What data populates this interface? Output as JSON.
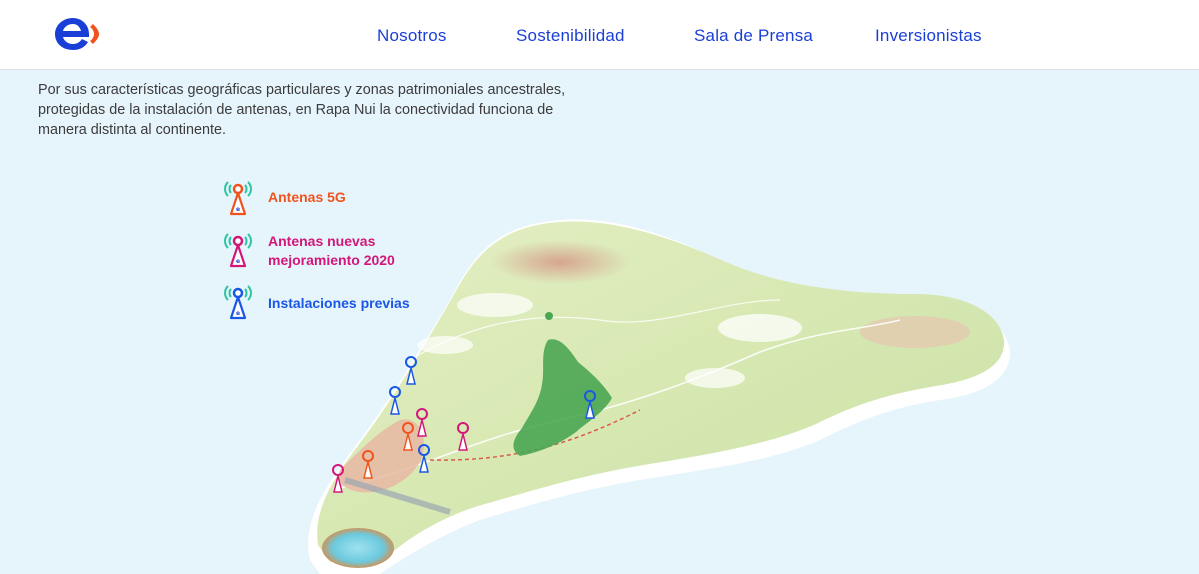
{
  "header": {
    "logo_name": "enel-logo",
    "nav": [
      {
        "label": "Nosotros"
      },
      {
        "label": "Sostenibilidad"
      },
      {
        "label": "Sala de Prensa"
      },
      {
        "label": "Inversionistas"
      }
    ]
  },
  "intro": {
    "text": "Por sus características geográficas particulares y zonas patrimoniales ancestrales, protegidas de la instalación de antenas, en Rapa Nui la conectividad funciona de manera distinta al continente."
  },
  "legend": {
    "items": [
      {
        "label": "Antenas 5G",
        "color": "#f0541e",
        "icon": "antenna-5g-icon"
      },
      {
        "label": "Antenas nuevas mejoramiento 2020",
        "color": "#d3177a",
        "icon": "antenna-new-icon"
      },
      {
        "label": "Instalaciones previas",
        "color": "#1a57e6",
        "icon": "antenna-previous-icon"
      }
    ]
  },
  "colors": {
    "brand_blue": "#1a3fd6",
    "brand_orange": "#f0541e",
    "sea": "#e6f4fb",
    "land": "#d9e8b6",
    "forest": "#4aa653"
  }
}
